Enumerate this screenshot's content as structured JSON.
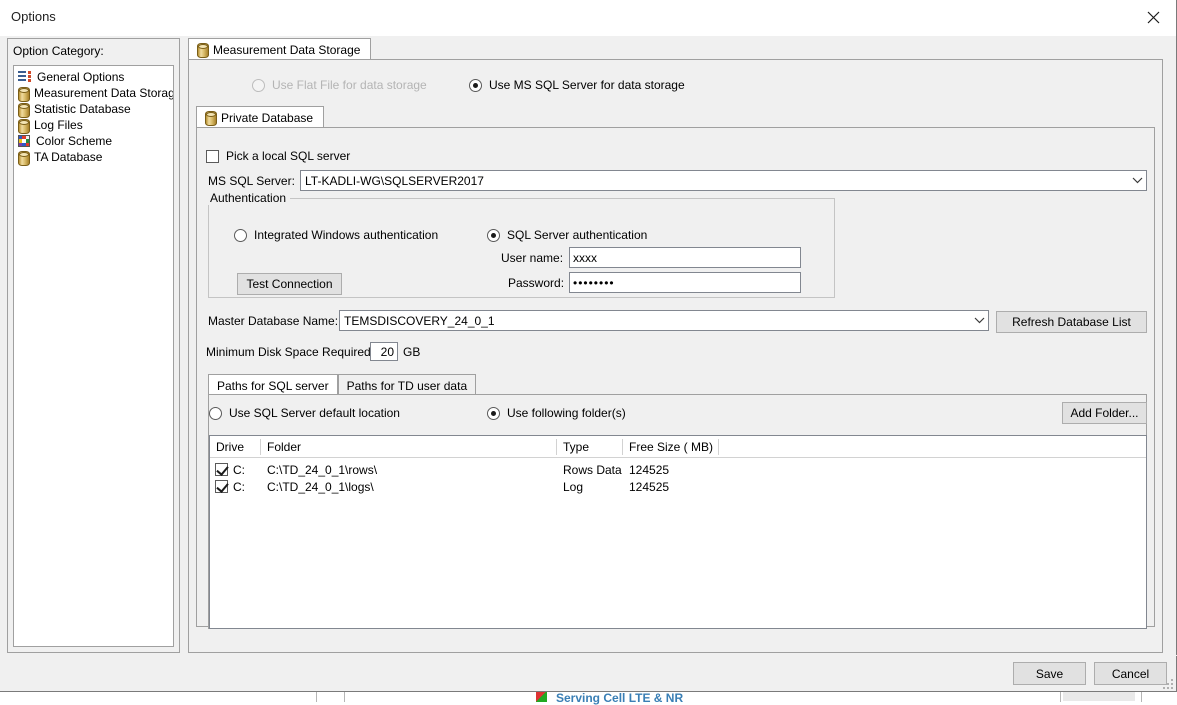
{
  "window": {
    "title": "Options",
    "close_icon": "close-icon"
  },
  "sidebar": {
    "title": "Option Category:",
    "items": [
      {
        "label": "General Options",
        "icon": "list-icon",
        "selected": false
      },
      {
        "label": "Measurement Data Storage",
        "icon": "database-icon",
        "selected": false
      },
      {
        "label": "Statistic Database",
        "icon": "database-icon",
        "selected": false
      },
      {
        "label": "Log Files",
        "icon": "database-icon",
        "selected": false
      },
      {
        "label": "Color Scheme",
        "icon": "palette-icon",
        "selected": false
      },
      {
        "label": "TA Database",
        "icon": "database-icon",
        "selected": false
      }
    ]
  },
  "main": {
    "outer_tab": {
      "label": "Measurement Data Storage",
      "icon": "database-icon",
      "active": true
    },
    "storage_mode": {
      "flat_file": {
        "label": "Use Flat File for data storage",
        "selected": false,
        "disabled": true
      },
      "ms_sql": {
        "label": "Use MS SQL Server for data storage",
        "selected": true,
        "disabled": false
      }
    },
    "inner_tab": {
      "label": "Private Database",
      "icon": "database-icon",
      "active": true
    },
    "pick_local": {
      "label": "Pick a local SQL server",
      "checked": false
    },
    "ms_sql_server": {
      "label": "MS SQL Server:",
      "value": "LT-KADLI-WG\\SQLSERVER2017"
    },
    "authentication": {
      "legend": "Authentication",
      "integrated": {
        "label": "Integrated Windows authentication",
        "selected": false
      },
      "sql_server": {
        "label": "SQL Server authentication",
        "selected": true
      },
      "user_name": {
        "label": "User name:",
        "value": "xxxx"
      },
      "password": {
        "label": "Password:",
        "value": "••••••••"
      },
      "test_connection_label": "Test Connection"
    },
    "master_database": {
      "label": "Master Database Name:",
      "value": "TEMSDISCOVERY_24_0_1"
    },
    "refresh_db_label": "Refresh Database List",
    "min_disk": {
      "label": "Minimum Disk Space Required:",
      "value": "20",
      "unit": "GB"
    },
    "paths_tabs": [
      {
        "label": "Paths for SQL server",
        "active": true
      },
      {
        "label": "Paths for TD user data",
        "active": false
      }
    ],
    "path_mode": {
      "default_location": {
        "label": "Use SQL Server default location",
        "selected": false
      },
      "following_folders": {
        "label": "Use following folder(s)",
        "selected": true
      }
    },
    "add_folder_label": "Add Folder...",
    "grid": {
      "columns": [
        "Drive",
        "Folder",
        "Type",
        "Free Size ( MB)"
      ],
      "rows": [
        {
          "checked": true,
          "drive": "C:",
          "folder": "C:\\TD_24_0_1\\rows\\",
          "type": "Rows Data",
          "free_size": "124525"
        },
        {
          "checked": true,
          "drive": "C:",
          "folder": "C:\\TD_24_0_1\\logs\\",
          "type": "Log",
          "free_size": "124525"
        }
      ]
    }
  },
  "footer": {
    "save_label": "Save",
    "cancel_label": "Cancel"
  },
  "background": {
    "text": "Serving Cell LTE & NR"
  }
}
